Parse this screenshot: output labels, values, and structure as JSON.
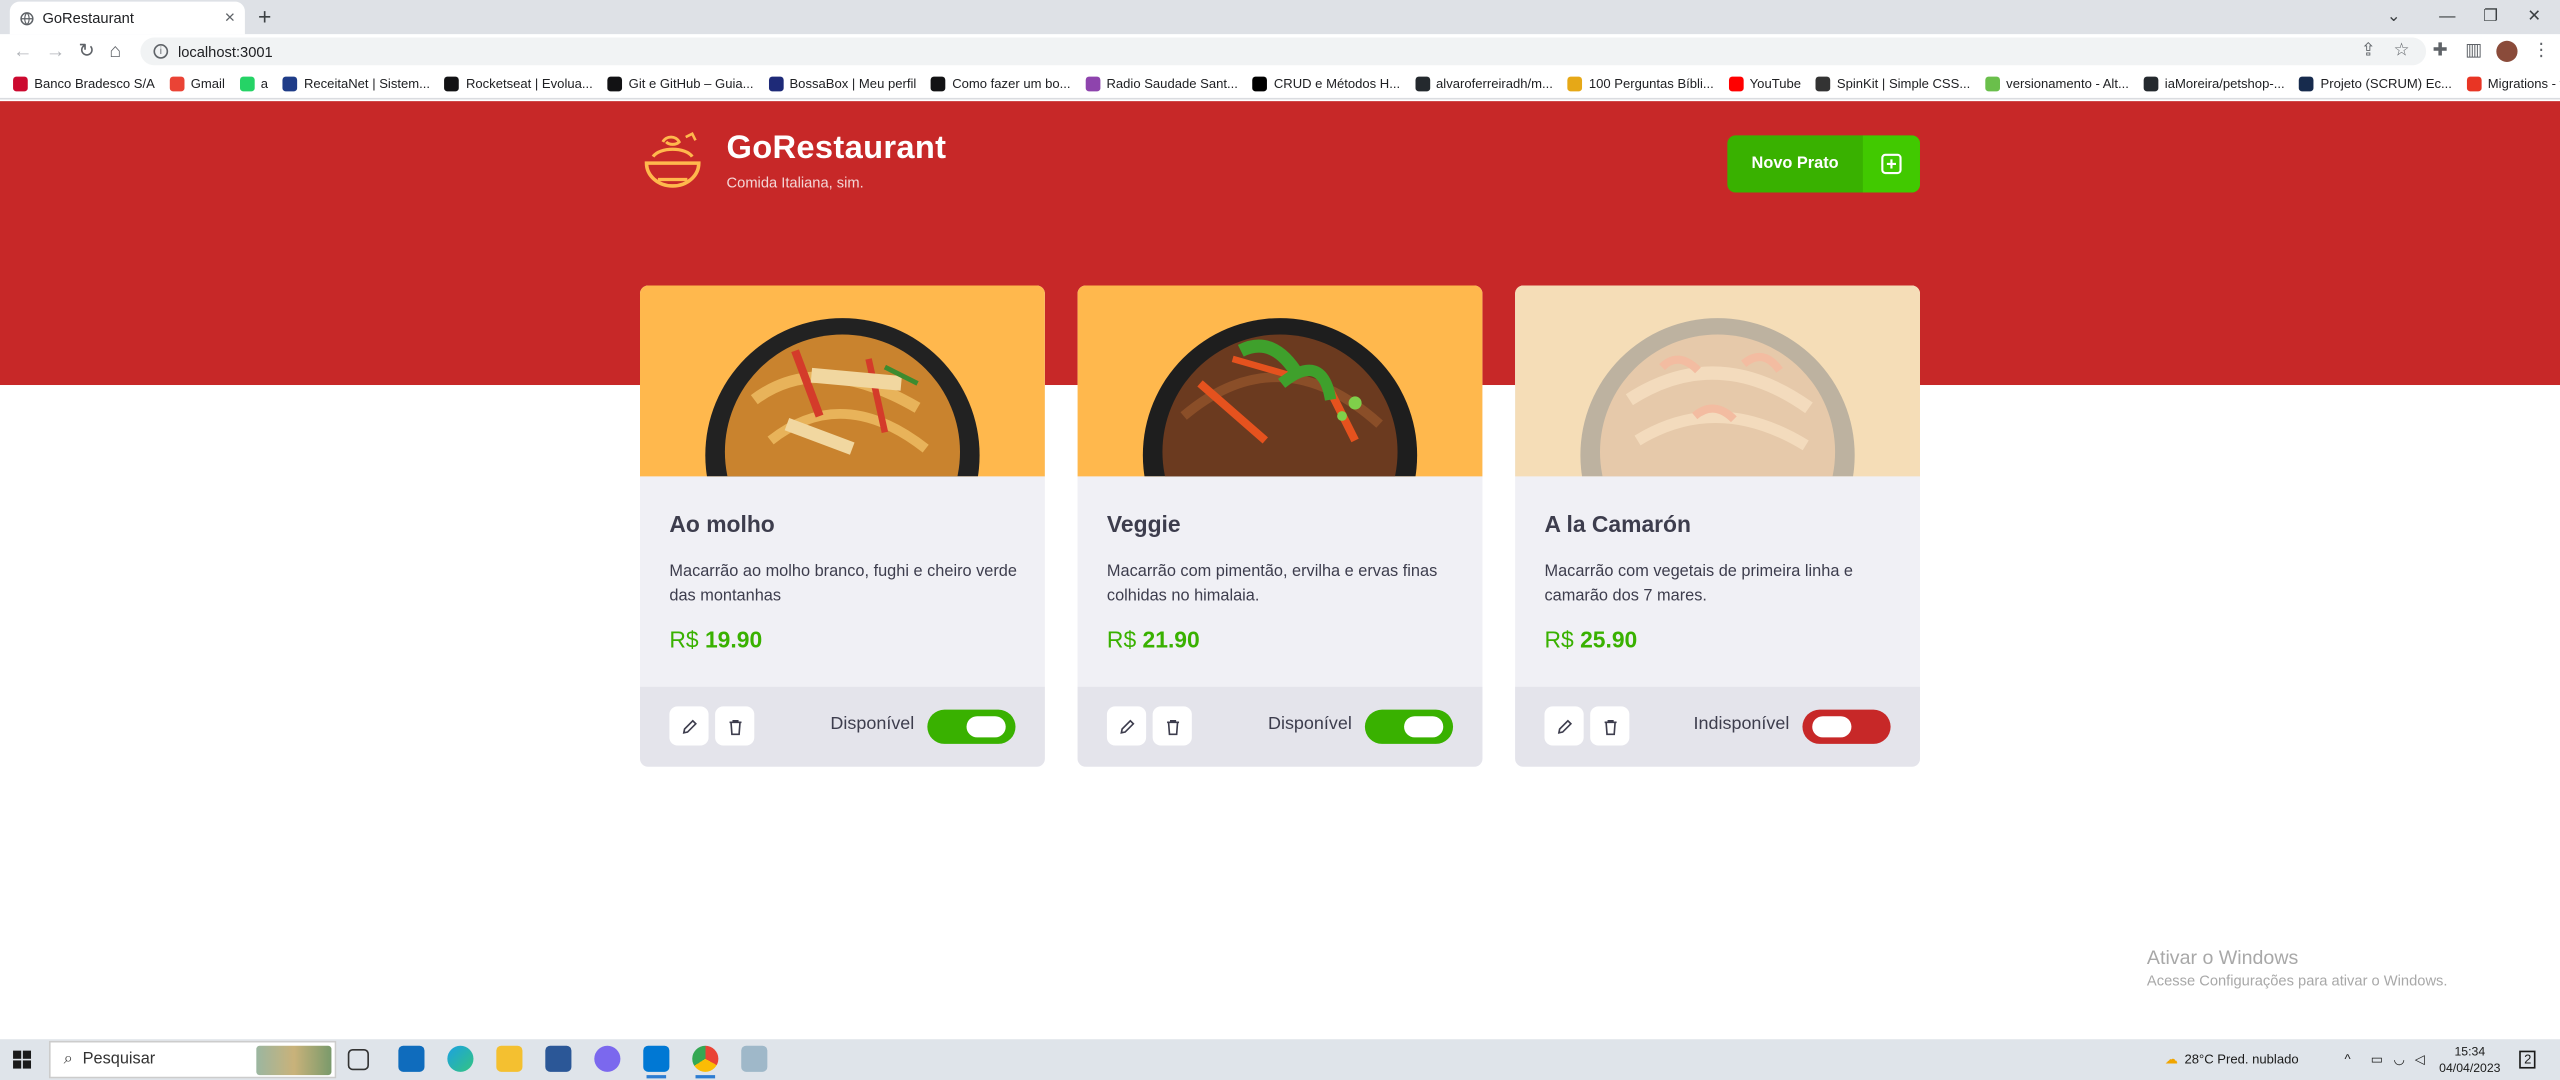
{
  "browser": {
    "tab_title": "GoRestaurant",
    "tab_close": "×",
    "new_tab": "+",
    "url": "localhost:3001",
    "bookmarks": [
      {
        "label": "Banco Bradesco S/A",
        "color": "#cc092f"
      },
      {
        "label": "Gmail",
        "color": "#ea4335"
      },
      {
        "label": "a",
        "color": "#25d366"
      },
      {
        "label": "ReceitaNet | Sistem...",
        "color": "#1f3c88"
      },
      {
        "label": "Rocketseat | Evolua...",
        "color": "#121214"
      },
      {
        "label": "Git e GitHub – Guia...",
        "color": "#121214"
      },
      {
        "label": "BossaBox | Meu perfil",
        "color": "#1e2a78"
      },
      {
        "label": "Como fazer um bo...",
        "color": "#121214"
      },
      {
        "label": "Radio Saudade Sant...",
        "color": "#8e44ad"
      },
      {
        "label": "CRUD e Métodos H...",
        "color": "#000000"
      },
      {
        "label": "alvaroferreiradh/m...",
        "color": "#24292e"
      },
      {
        "label": "100 Perguntas Bíbli...",
        "color": "#e6a817"
      },
      {
        "label": "YouTube",
        "color": "#ff0000"
      },
      {
        "label": "SpinKit | Simple CSS...",
        "color": "#333333"
      },
      {
        "label": "versionamento - Alt...",
        "color": "#6abf4b"
      },
      {
        "label": "iaMoreira/petshop-...",
        "color": "#24292e"
      },
      {
        "label": "Projeto (SCRUM) Ec...",
        "color": "#172b4d"
      },
      {
        "label": "Migrations - typeorm",
        "color": "#e83524"
      }
    ]
  },
  "app": {
    "title": "GoRestaurant",
    "subtitle": "Comida Italiana, sim.",
    "new_button": "Novo Prato",
    "colors": {
      "primary": "#c72828",
      "green": "#39b100",
      "accent": "#ffb84d"
    }
  },
  "foods": [
    {
      "name": "Ao molho",
      "description": "Macarrão ao molho branco, fughi e cheiro verde das montanhas",
      "currency": "R$",
      "price": "19.90",
      "status": "Disponível",
      "available": true
    },
    {
      "name": "Veggie",
      "description": "Macarrão com pimentão, ervilha e ervas finas colhidas no himalaia.",
      "currency": "R$",
      "price": "21.90",
      "status": "Disponível",
      "available": true
    },
    {
      "name": "A la Camarón",
      "description": "Macarrão com vegetais de primeira linha e camarão dos 7 mares.",
      "currency": "R$",
      "price": "25.90",
      "status": "Indisponível",
      "available": false
    }
  ],
  "os": {
    "watermark_title": "Ativar o Windows",
    "watermark_text": "Acesse Configurações para ativar o Windows.",
    "search_placeholder": "Pesquisar",
    "weather": "28°C  Pred. nublado",
    "time": "15:34",
    "date": "04/04/2023",
    "notification_count": "2"
  }
}
